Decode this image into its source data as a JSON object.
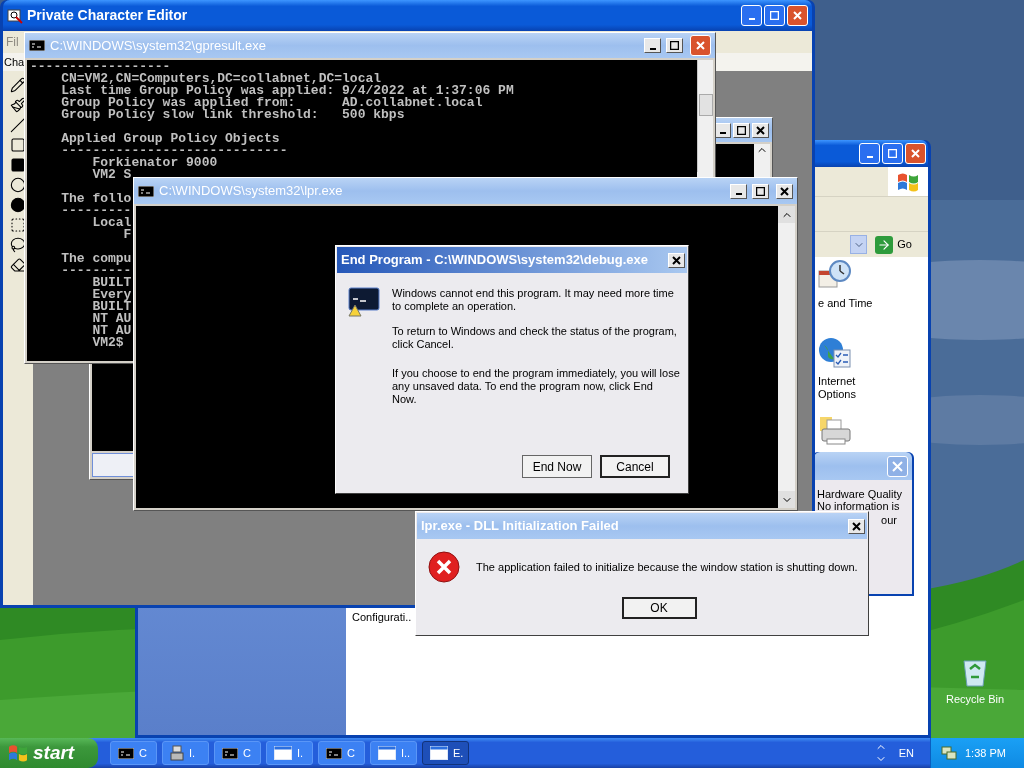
{
  "desktop": {
    "icons": [
      {
        "label": "Recycle Bin"
      }
    ]
  },
  "control_panel": {
    "go_button": "Go",
    "items": [
      {
        "label": "e and Time",
        "kind": "clock"
      },
      {
        "label": "Internet Options",
        "kind": "globe"
      },
      {
        "kind": "printer"
      }
    ],
    "partial_label": "Configurati.."
  },
  "hardware_popup": {
    "lines": [
      "Hardware Quality",
      "No information is"
    ],
    "tail": "our"
  },
  "char_editor": {
    "title": "Private Character Editor",
    "menu": "Fil",
    "label": "Cha"
  },
  "gpresult": {
    "title": "C:\\WINDOWS\\system32\\gpresult.exe",
    "blocks": [
      [
        "------------------",
        "    CN=VM2,CN=Computers,DC=collabnet,DC=local",
        "    Last time Group Policy was applied: 9/4/2022 at 1:37:06 PM",
        "    Group Policy was applied from:      AD.collabnet.local",
        "    Group Policy slow link threshold:   500 kbps"
      ],
      [
        "    Applied Group Policy Objects",
        "    -----------------------------",
        "        Forkienator 9000",
        "        VM2 S"
      ],
      [
        "    The follo",
        "    ---------",
        "        Local",
        "            F"
      ],
      [
        "    The compu",
        "    ---------",
        "        BUILT",
        "        Every",
        "        BUILT",
        "        NT AU",
        "        NT AU",
        "        VM2$"
      ]
    ]
  },
  "lpr": {
    "title": "C:\\WINDOWS\\system32\\lpr.exe"
  },
  "end_program": {
    "title": "End Program - C:\\WINDOWS\\system32\\debug.exe",
    "paragraphs": [
      "Windows cannot end this program. It may need more time to complete an operation.",
      "To return to Windows and check the status of the program, click Cancel.",
      "If you choose to end the program immediately, you will lose any unsaved data. To end the program now, click End Now."
    ],
    "buttons": [
      {
        "label": "End Now",
        "selected": false
      },
      {
        "label": "Cancel",
        "selected": true
      }
    ]
  },
  "dll_error": {
    "title": "lpr.exe - DLL Initialization Failed",
    "message": "The application failed to initialize because the window station is shutting down.",
    "buttons": [
      {
        "label": "OK",
        "selected": true
      }
    ]
  },
  "taskbar": {
    "start": "start",
    "tasks": [
      {
        "kind": "console",
        "label": "C",
        "selected": false
      },
      {
        "kind": "program",
        "label": "I.",
        "selected": false
      },
      {
        "kind": "console",
        "label": "C",
        "selected": false
      },
      {
        "kind": "window",
        "label": "I.",
        "selected": false
      },
      {
        "kind": "console",
        "label": "C",
        "selected": false
      },
      {
        "kind": "window",
        "label": "I..",
        "selected": false
      },
      {
        "kind": "window",
        "label": "E.",
        "selected": true
      }
    ],
    "language": "EN",
    "clock": "1:38 PM"
  }
}
